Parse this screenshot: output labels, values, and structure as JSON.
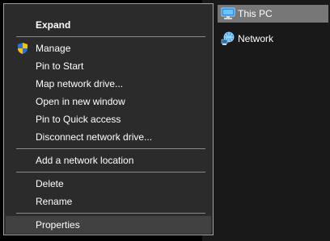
{
  "navigation_pane": {
    "items": [
      {
        "label": "This PC",
        "icon": "computer-icon",
        "selected": true
      },
      {
        "label": "Network",
        "icon": "network-icon",
        "selected": false
      }
    ]
  },
  "context_menu": {
    "items": [
      {
        "label": "Expand",
        "bold": true
      },
      {
        "label": "Manage",
        "icon": "uac-shield-icon"
      },
      {
        "label": "Pin to Start"
      },
      {
        "label": "Map network drive..."
      },
      {
        "label": "Open in new window"
      },
      {
        "label": "Pin to Quick access"
      },
      {
        "label": "Disconnect network drive..."
      },
      {
        "label": "Add a network location"
      },
      {
        "label": "Delete"
      },
      {
        "label": "Rename"
      },
      {
        "label": "Properties",
        "highlighted": true
      }
    ]
  },
  "colors": {
    "background": "#000000",
    "nav_pane": "#191919",
    "nav_selected": "#777777",
    "menu_background": "#2b2b2b",
    "menu_border": "#a0a0a0",
    "menu_highlight": "#414141",
    "text": "#ffffff"
  }
}
